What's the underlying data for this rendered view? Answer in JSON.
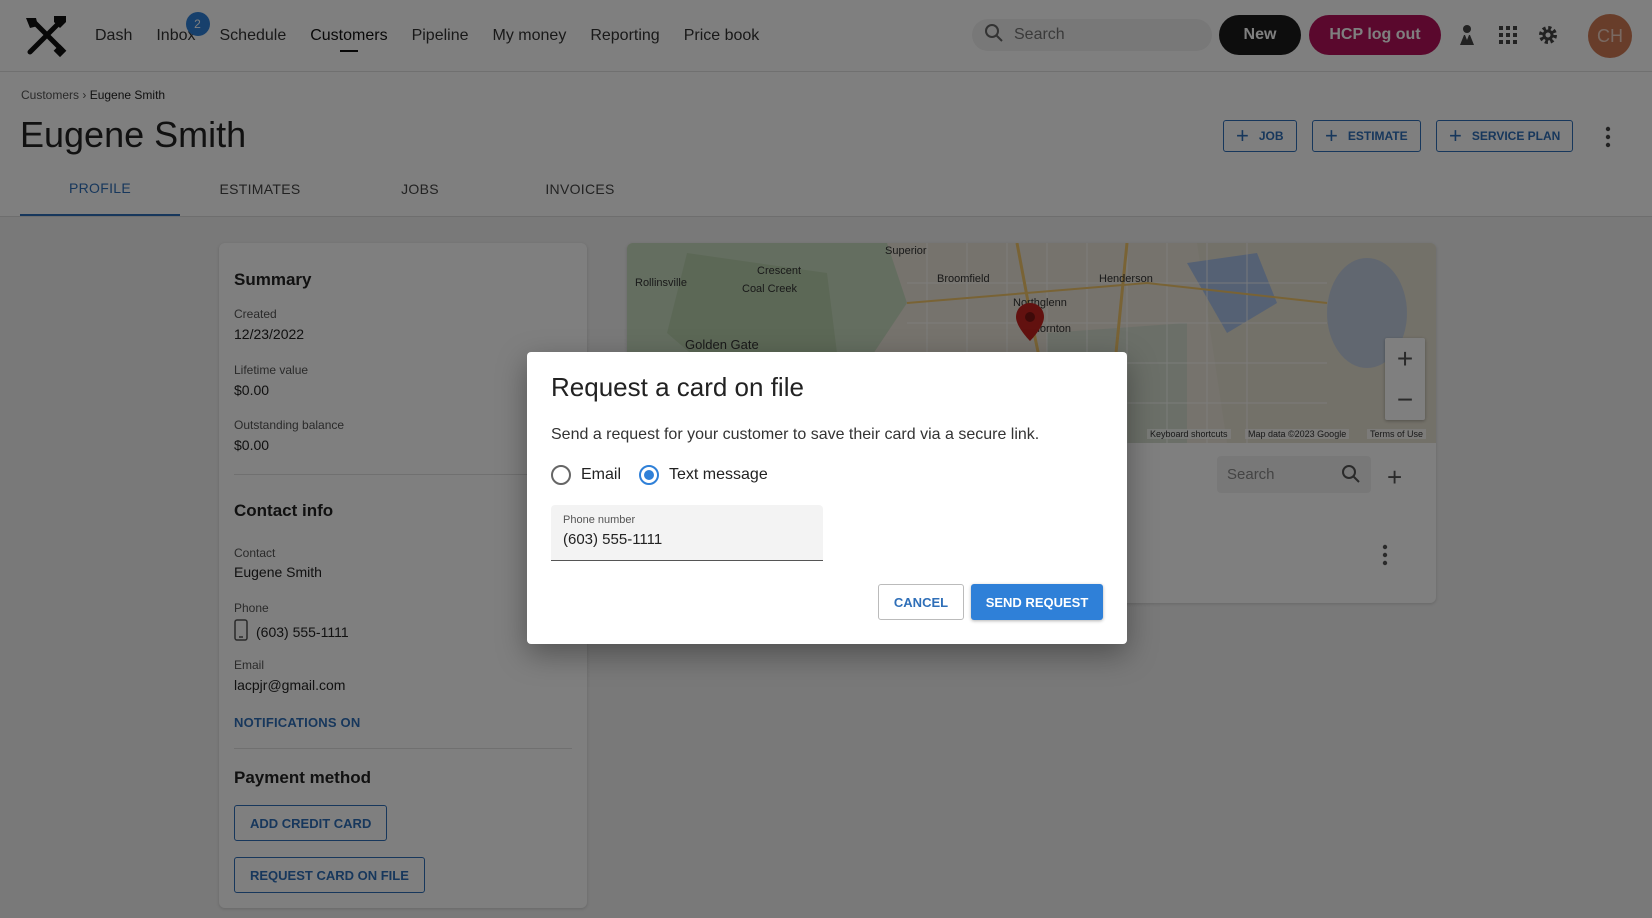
{
  "nav": {
    "items": [
      "Dash",
      "Inbox",
      "Schedule",
      "Customers",
      "Pipeline",
      "My money",
      "Reporting",
      "Price book"
    ],
    "inbox_badge": "2",
    "active": "Customers",
    "search_placeholder": "Search",
    "new_label": "New",
    "logout_label": "HCP log out",
    "avatar_initials": "CH"
  },
  "header": {
    "breadcrumb_root": "Customers",
    "breadcrumb_sep": "›",
    "breadcrumb_current": "Eugene Smith",
    "title": "Eugene Smith",
    "actions": [
      "JOB",
      "ESTIMATE",
      "SERVICE PLAN"
    ],
    "tabs": [
      "PROFILE",
      "ESTIMATES",
      "JOBS",
      "INVOICES"
    ]
  },
  "summary": {
    "title": "Summary",
    "created_label": "Created",
    "created_value": "12/23/2022",
    "lifetime_label": "Lifetime value",
    "lifetime_value": "$0.00",
    "balance_label": "Outstanding balance",
    "balance_value": "$0.00",
    "contact_title": "Contact info",
    "contact_label": "Contact",
    "contact_value": "Eugene Smith",
    "phone_label": "Phone",
    "phone_value": "(603) 555-1111",
    "email_label": "Email",
    "email_value": "lacpjr@gmail.com",
    "notifications": "NOTIFICATIONS ON",
    "payment_title": "Payment method",
    "add_card": "ADD CREDIT CARD",
    "request_card": "REQUEST CARD ON FILE"
  },
  "map": {
    "labels": [
      "Superior",
      "Broomfield",
      "Henderson",
      "Rollinsville",
      "Crescent",
      "Coal Creek",
      "Northglenn",
      "Thornton",
      "Golden Gate"
    ],
    "attrib_shortcuts": "Keyboard shortcuts",
    "attrib_data": "Map data ©2023 Google",
    "attrib_terms": "Terms of Use",
    "search_placeholder": "Search"
  },
  "dialog": {
    "title": "Request a card on file",
    "text": "Send a request for your customer to save their card via a secure link.",
    "option_email": "Email",
    "option_text": "Text message",
    "selected": "Text message",
    "phone_label": "Phone number",
    "phone_value": "(603) 555-1111",
    "cancel": "CANCEL",
    "send": "SEND REQUEST"
  }
}
